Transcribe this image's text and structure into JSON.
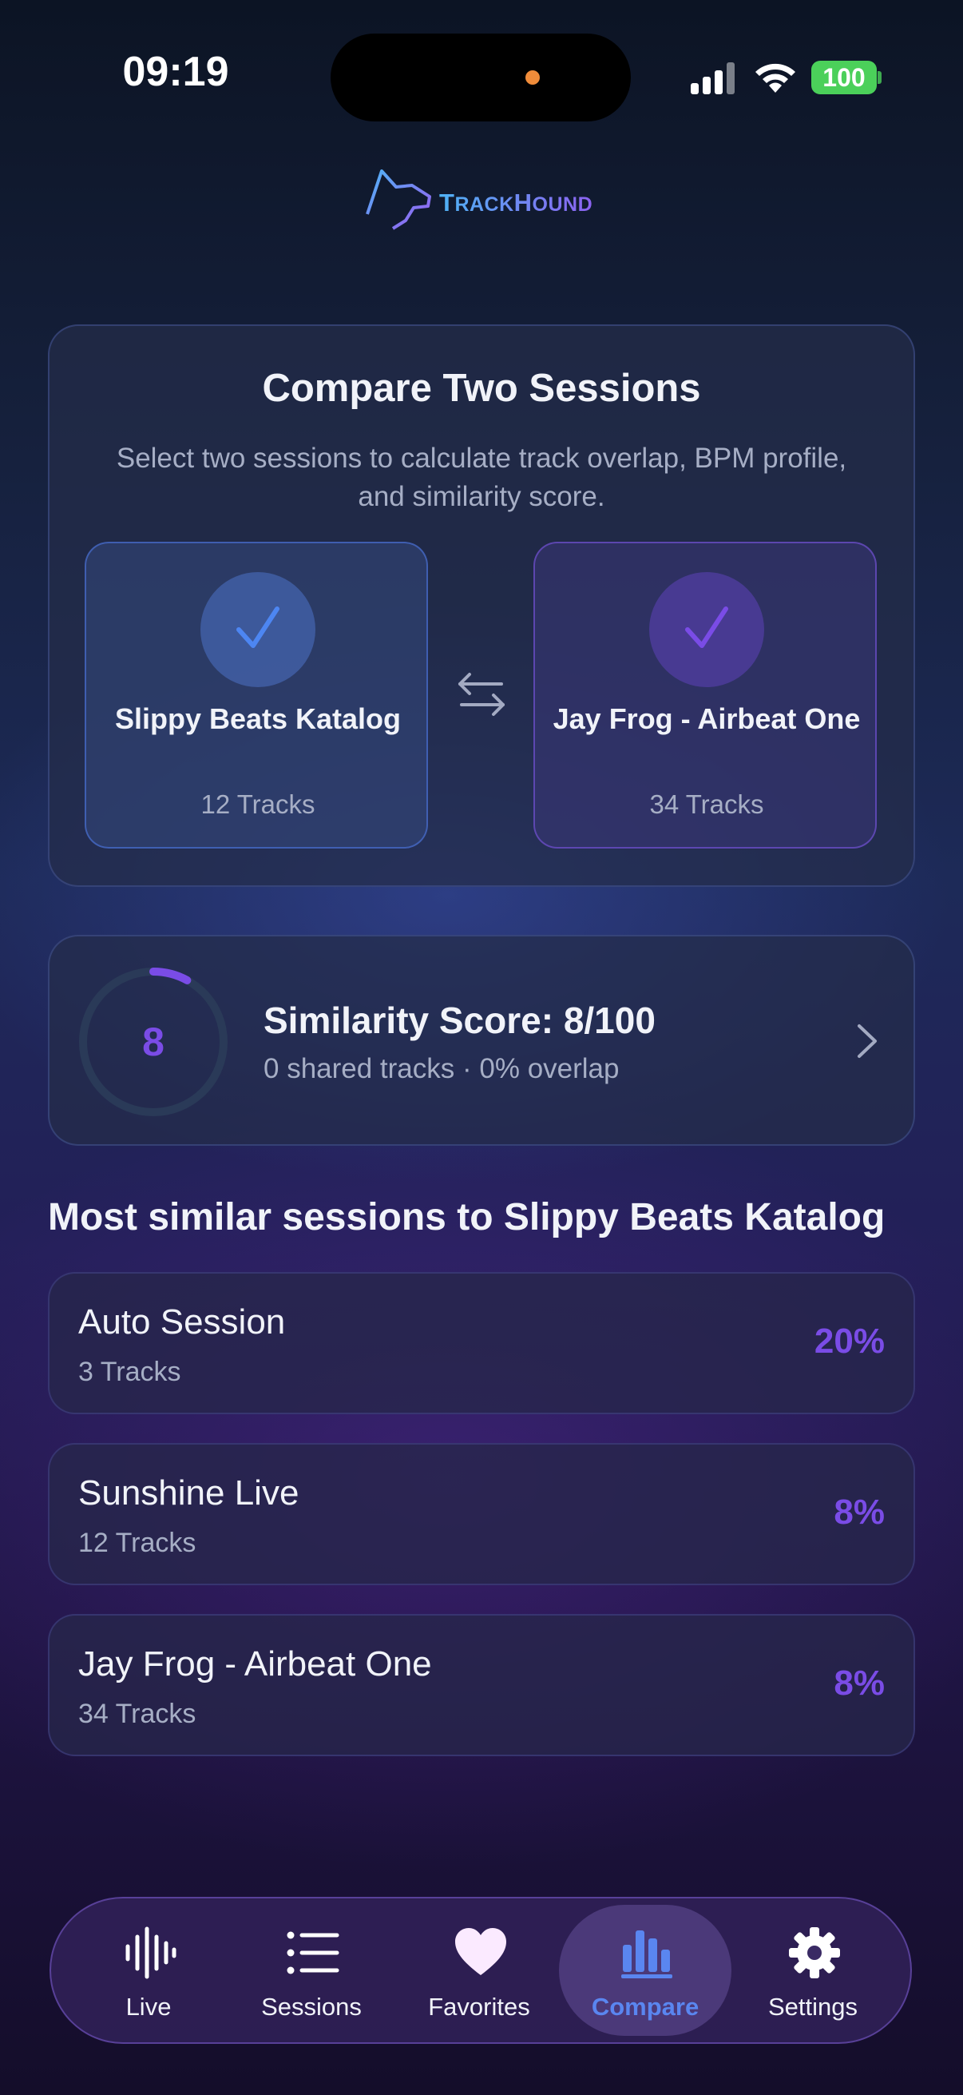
{
  "status_bar": {
    "time": "09:19",
    "battery": "100"
  },
  "brand": {
    "name_big": "T",
    "name_rest": "RACK",
    "name_big2": "H",
    "name_rest2": "OUND"
  },
  "compare": {
    "title": "Compare Two Sessions",
    "description": "Select two sessions to calculate track overlap, BPM profile, and similarity score.",
    "session_a": {
      "name": "Slippy Beats Katalog",
      "count": "12 Tracks"
    },
    "session_b": {
      "name": "Jay  Frog - Airbeat One",
      "count": "34 Tracks"
    }
  },
  "similarity": {
    "score": "8",
    "score_value": 8,
    "score_max": 100,
    "title": "Similarity Score: 8/100",
    "subtitle": "0 shared tracks · 0% overlap"
  },
  "similar_sessions": {
    "title": "Most similar sessions to Slippy Beats Katalog",
    "items": [
      {
        "name": "Auto Session",
        "count": "3 Tracks",
        "percent": "20%"
      },
      {
        "name": "Sunshine Live",
        "count": "12 Tracks",
        "percent": "8%"
      },
      {
        "name": "Jay  Frog - Airbeat One",
        "count": "34 Tracks",
        "percent": "8%"
      }
    ]
  },
  "tabs": [
    {
      "label": "Live",
      "icon": "waveform-icon"
    },
    {
      "label": "Sessions",
      "icon": "list-icon"
    },
    {
      "label": "Favorites",
      "icon": "heart-icon"
    },
    {
      "label": "Compare",
      "icon": "bar-chart-icon",
      "active": true
    },
    {
      "label": "Settings",
      "icon": "gear-icon"
    }
  ],
  "colors": {
    "accent_purple": "#7a4ce6",
    "accent_blue": "#5a86f0",
    "battery_green": "#4bd05a"
  }
}
